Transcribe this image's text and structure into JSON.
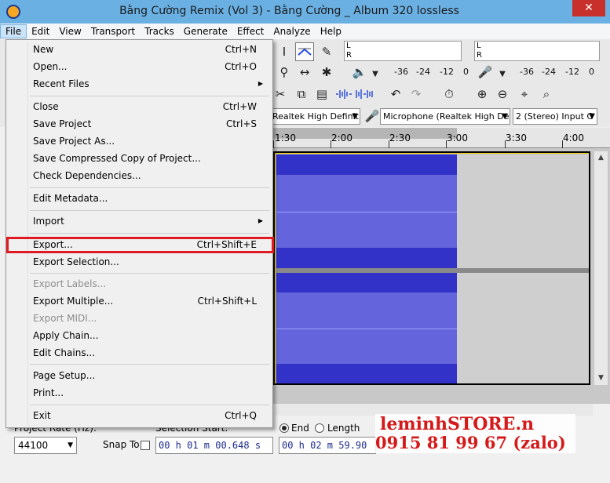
{
  "window": {
    "title": "Bằng Cường Remix (Vol 3) - Bằng Cường _ Album 320 lossless",
    "close_glyph": "✕"
  },
  "menubar": [
    "File",
    "Edit",
    "View",
    "Transport",
    "Tracks",
    "Generate",
    "Effect",
    "Analyze",
    "Help"
  ],
  "file_menu": {
    "items": [
      {
        "label": "New",
        "shortcut": "Ctrl+N"
      },
      {
        "label": "Open...",
        "shortcut": "Ctrl+O"
      },
      {
        "label": "Recent Files",
        "submenu": true
      },
      {
        "separator": true
      },
      {
        "label": "Close",
        "shortcut": "Ctrl+W"
      },
      {
        "label": "Save Project",
        "shortcut": "Ctrl+S"
      },
      {
        "label": "Save Project As..."
      },
      {
        "label": "Save Compressed Copy of Project..."
      },
      {
        "label": "Check Dependencies..."
      },
      {
        "separator": true
      },
      {
        "label": "Edit Metadata..."
      },
      {
        "separator": true
      },
      {
        "label": "Import",
        "submenu": true
      },
      {
        "separator": true
      },
      {
        "label": "Export...",
        "shortcut": "Ctrl+Shift+E",
        "highlighted": true
      },
      {
        "label": "Export Selection..."
      },
      {
        "separator": true
      },
      {
        "label": "Export Labels...",
        "disabled": true
      },
      {
        "label": "Export Multiple...",
        "shortcut": "Ctrl+Shift+L"
      },
      {
        "label": "Export MIDI...",
        "disabled": true
      },
      {
        "label": "Apply Chain..."
      },
      {
        "label": "Edit Chains..."
      },
      {
        "separator": true
      },
      {
        "label": "Page Setup..."
      },
      {
        "label": "Print..."
      },
      {
        "separator": true
      },
      {
        "label": "Exit",
        "shortcut": "Ctrl+Q"
      }
    ]
  },
  "meters": {
    "playback": {
      "l": "L",
      "r": "R",
      "scale": [
        "-36",
        "-24",
        "-12",
        "0"
      ]
    },
    "record": {
      "l": "L",
      "r": "R",
      "scale": [
        "-36",
        "-24",
        "-12",
        "0"
      ]
    }
  },
  "devices": {
    "output": "Realtek High Definit",
    "input": "Microphone (Realtek High Defi",
    "channels": "2 (Stereo) Input C"
  },
  "timeline": {
    "ticks": [
      "1:30",
      "2:00",
      "2:30",
      "3:00",
      "3:30",
      "4:00"
    ]
  },
  "selection_bar": {
    "project_rate_label": "Project Rate (Hz):",
    "project_rate": "44100",
    "snap_to_label": "Snap To",
    "selection_start_label": "Selection Start:",
    "end_label": "End",
    "length_label": "Length",
    "start_time": "00 h 01 m 00.648 s",
    "end_time": "00 h 02 m 59.90"
  },
  "watermark": {
    "line1": "leminhSTORE.n",
    "line2": "0915 81 99 67 (zalo)"
  },
  "colors": {
    "waveform": "#3232c8",
    "waveform_rms": "#6464dc",
    "highlight_box": "#e01a22",
    "titlebar": "#6ab0e3"
  }
}
